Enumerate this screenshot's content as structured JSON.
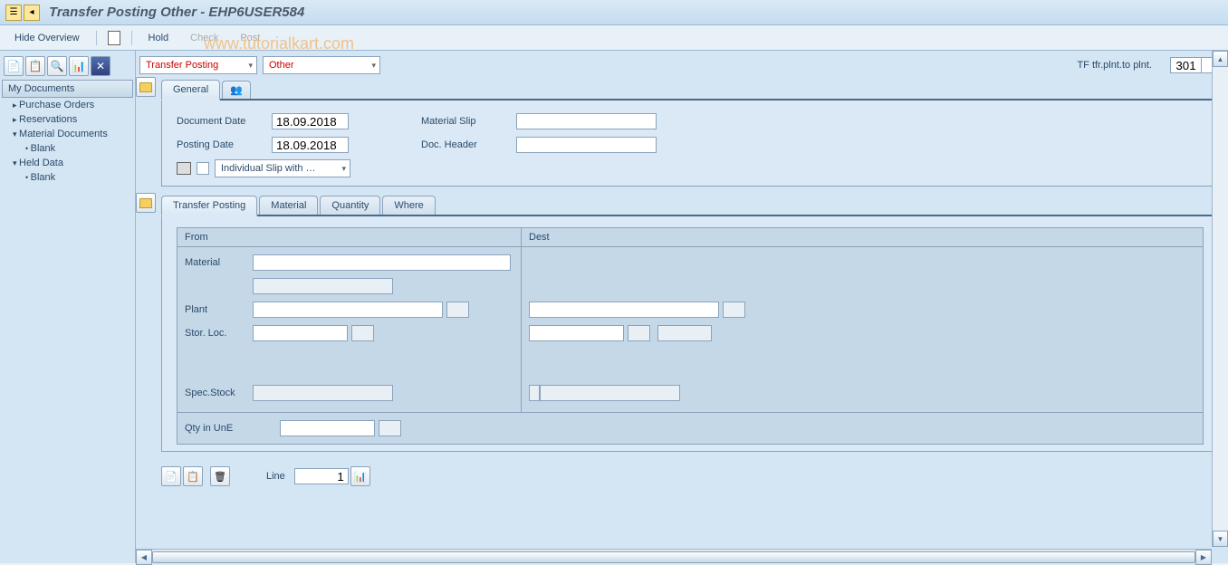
{
  "title": "Transfer Posting Other - EHP6USER584",
  "toolbar": {
    "hide_overview": "Hide Overview",
    "hold": "Hold",
    "check": "Check",
    "post": "Post"
  },
  "watermark": "www.tutorialkart.com",
  "sidebar": {
    "header": "My Documents",
    "items": [
      {
        "label": "Purchase Orders",
        "expanded": false,
        "leaf": false
      },
      {
        "label": "Reservations",
        "expanded": false,
        "leaf": false
      },
      {
        "label": "Material Documents",
        "expanded": true,
        "leaf": false
      },
      {
        "label": "Blank",
        "leaf": true,
        "lvl": 2
      },
      {
        "label": "Held Data",
        "expanded": true,
        "leaf": false
      },
      {
        "label": "Blank",
        "leaf": true,
        "lvl": 2
      }
    ]
  },
  "action": {
    "dropdown1": "Transfer Posting",
    "dropdown2": "Other",
    "tf_label": "TF tfr.plnt.to plnt.",
    "tf_value": "301"
  },
  "tabs1": {
    "general": "General"
  },
  "general_panel": {
    "doc_date_label": "Document Date",
    "doc_date_value": "18.09.2018",
    "posting_date_label": "Posting Date",
    "posting_date_value": "18.09.2018",
    "material_slip_label": "Material Slip",
    "material_slip_value": "",
    "doc_header_label": "Doc. Header",
    "doc_header_value": "",
    "slip_dropdown": "Individual Slip with …"
  },
  "tabs2": {
    "transfer_posting": "Transfer Posting",
    "material": "Material",
    "quantity": "Quantity",
    "where": "Where"
  },
  "transfer_panel": {
    "from_label": "From",
    "dest_label": "Dest",
    "material_label": "Material",
    "plant_label": "Plant",
    "stor_loc_label": "Stor. Loc.",
    "spec_stock_label": "Spec.Stock",
    "qty_label": "Qty in UnE"
  },
  "footer": {
    "line_label": "Line",
    "line_value": "1"
  }
}
